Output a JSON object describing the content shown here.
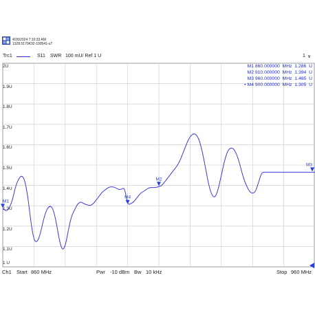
{
  "header": {
    "timestamp": "4/26/2024 7:10:33 AM",
    "instrument_id": "1328.5170K92-100541-uT",
    "brand_icon": "rohde-schwarz-logo-icon"
  },
  "trace_bar": {
    "trace_name": "Trc1",
    "param": "S11",
    "format": "SWR",
    "scale": "100 mU/ Ref 1 U",
    "channel_badge": "1",
    "menu_indicator": "∨"
  },
  "markers": [
    {
      "label": "M1",
      "freq": "860.000000",
      "unit": "MHz",
      "value": "1.286",
      "vunit": "U",
      "active": false
    },
    {
      "label": "M2",
      "freq": "910.000000",
      "unit": "MHz",
      "value": "1.394",
      "vunit": "U",
      "active": false
    },
    {
      "label": "M3",
      "freq": "960.000000",
      "unit": "MHz",
      "value": "1.465",
      "vunit": "U",
      "active": false
    },
    {
      "label": "M4",
      "freq": "900.000000",
      "unit": "MHz",
      "value": "1.305",
      "vunit": "U",
      "active": true
    }
  ],
  "footer": {
    "channel": "Ch1",
    "start_label": "Start",
    "start_value": "860 MHz",
    "power_label": "Pwr",
    "power_value": "-10 dBm",
    "bw_label": "Bw",
    "bw_value": "10 kHz",
    "stop_label": "Stop",
    "stop_value": "960 MHz"
  },
  "colors": {
    "trace": "#3a3ad6",
    "marker": "#2a3fd8",
    "grid": "#c8c8c8",
    "text": "#1a1a1a"
  },
  "chart_data": {
    "type": "line",
    "title": "",
    "xlabel": "",
    "ylabel": "",
    "xlim": [
      860,
      960
    ],
    "ylim": [
      1.0,
      2.0
    ],
    "y_tick_labels": [
      "2U",
      "1.9U",
      "1.8U",
      "1.7U",
      "1.6U",
      "1.5U",
      "1.4U",
      "1.3U",
      "1.2U",
      "1.1U",
      "1 U"
    ],
    "grid": true,
    "series": [
      {
        "name": "Trc1",
        "x": [
          860,
          861.5,
          863,
          864,
          865,
          866,
          867,
          868,
          869,
          870,
          871,
          872,
          873,
          874,
          875,
          876,
          877,
          878,
          879,
          880,
          881,
          882,
          883,
          884,
          885,
          886,
          887,
          888,
          889,
          890,
          891,
          892,
          893,
          894,
          895,
          896,
          897,
          898,
          899,
          900,
          901,
          902,
          903,
          904,
          905,
          906,
          907,
          908,
          909,
          910,
          911,
          912,
          913,
          914,
          915,
          916,
          917,
          918,
          919,
          920,
          921,
          922,
          923,
          924,
          925,
          926,
          927,
          928,
          929,
          930,
          931,
          932,
          933,
          934,
          935,
          936,
          937,
          938,
          939,
          940,
          941,
          942,
          943,
          944,
          945,
          946,
          947,
          948,
          949,
          950,
          951,
          952,
          953,
          954,
          955,
          956,
          957,
          958,
          959,
          960
        ],
        "y": [
          1.286,
          1.27,
          1.32,
          1.39,
          1.43,
          1.45,
          1.43,
          1.35,
          1.22,
          1.13,
          1.12,
          1.16,
          1.23,
          1.28,
          1.3,
          1.29,
          1.23,
          1.14,
          1.08,
          1.1,
          1.18,
          1.25,
          1.28,
          1.31,
          1.32,
          1.31,
          1.305,
          1.3,
          1.31,
          1.33,
          1.35,
          1.37,
          1.38,
          1.392,
          1.394,
          1.39,
          1.38,
          1.38,
          1.39,
          1.305,
          1.31,
          1.32,
          1.34,
          1.36,
          1.37,
          1.38,
          1.39,
          1.39,
          1.39,
          1.394,
          1.4,
          1.42,
          1.44,
          1.46,
          1.48,
          1.5,
          1.53,
          1.57,
          1.61,
          1.64,
          1.655,
          1.65,
          1.62,
          1.56,
          1.48,
          1.4,
          1.35,
          1.34,
          1.38,
          1.45,
          1.52,
          1.57,
          1.585,
          1.58,
          1.55,
          1.5,
          1.44,
          1.4,
          1.37,
          1.36,
          1.37,
          1.42,
          1.465,
          1.465,
          1.465,
          1.465,
          1.465,
          1.465,
          1.465,
          1.465,
          1.465,
          1.465,
          1.465,
          1.465,
          1.465,
          1.465,
          1.465,
          1.465,
          1.465,
          1.465
        ]
      }
    ]
  }
}
